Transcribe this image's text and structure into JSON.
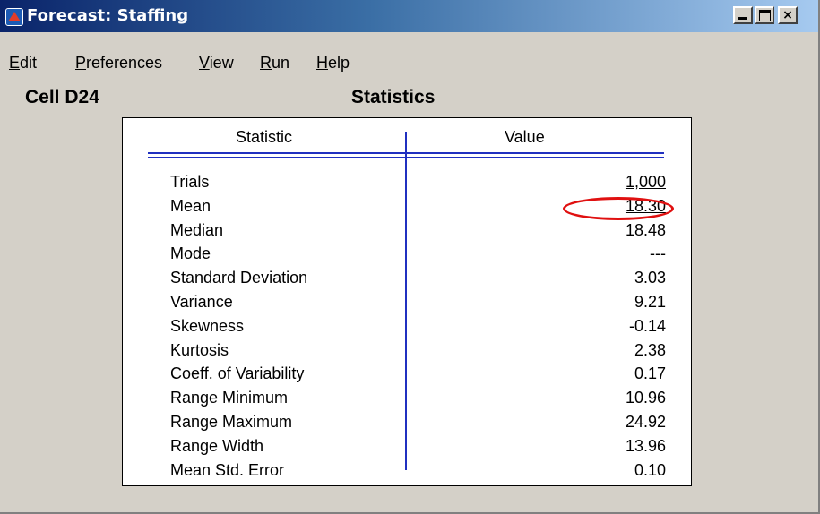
{
  "window": {
    "title": "Forecast: Staffing"
  },
  "menu": {
    "edit": "Edit",
    "preferences": "Preferences",
    "view": "View",
    "run": "Run",
    "help": "Help"
  },
  "header": {
    "cell": "Cell D24",
    "view_title": "Statistics"
  },
  "table": {
    "col_statistic": "Statistic",
    "col_value": "Value",
    "rows": [
      {
        "label": "Trials",
        "value": "1,000"
      },
      {
        "label": "Mean",
        "value": "18.30"
      },
      {
        "label": "Median",
        "value": "18.48"
      },
      {
        "label": "Mode",
        "value": "---"
      },
      {
        "label": "Standard Deviation",
        "value": "3.03"
      },
      {
        "label": "Variance",
        "value": "9.21"
      },
      {
        "label": "Skewness",
        "value": "-0.14"
      },
      {
        "label": "Kurtosis",
        "value": "2.38"
      },
      {
        "label": "Coeff. of Variability",
        "value": "0.17"
      },
      {
        "label": "Range Minimum",
        "value": "10.96"
      },
      {
        "label": "Range Maximum",
        "value": "24.92"
      },
      {
        "label": "Range Width",
        "value": "13.96"
      },
      {
        "label": "Mean Std. Error",
        "value": "0.10"
      }
    ]
  },
  "colors": {
    "accent_line": "#2030c0",
    "highlight": "#e01010",
    "titlebar": "#0a246a"
  }
}
